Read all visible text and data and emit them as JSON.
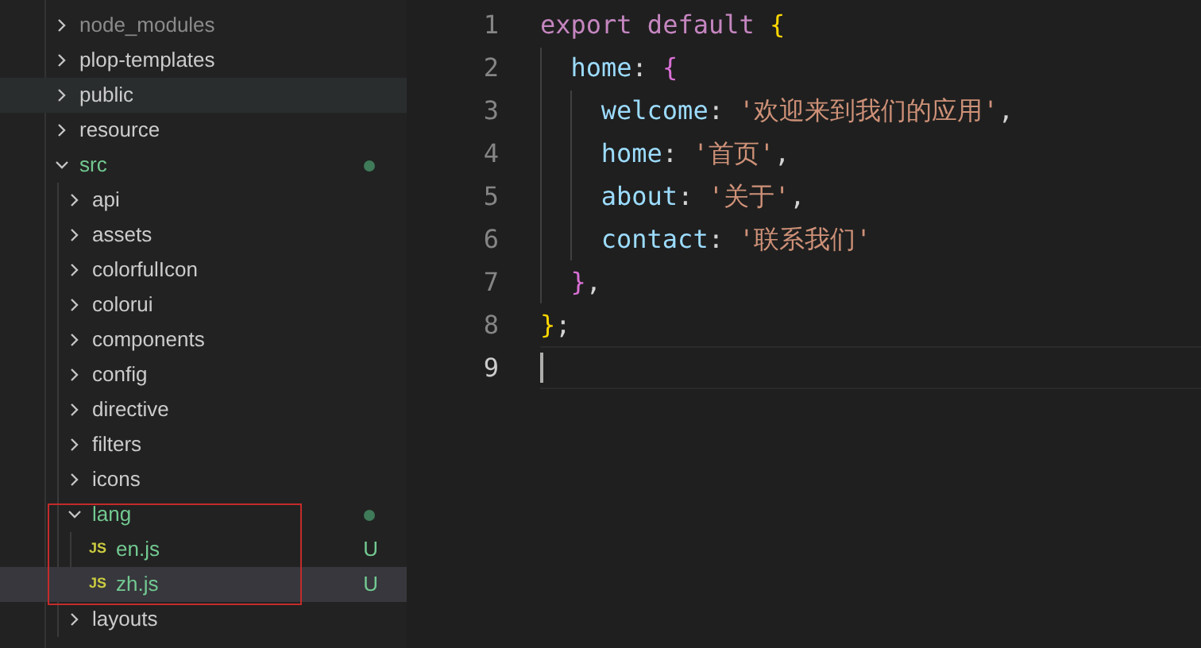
{
  "explorer": {
    "items": [
      {
        "label": "node_modules",
        "kind": "folder",
        "expanded": false,
        "ignored": true,
        "modified": false,
        "hovered": false,
        "selected": false,
        "outlined": false
      },
      {
        "label": "plop-templates",
        "kind": "folder",
        "expanded": false,
        "ignored": false,
        "modified": false,
        "hovered": false,
        "selected": false,
        "outlined": false
      },
      {
        "label": "public",
        "kind": "folder",
        "expanded": false,
        "ignored": false,
        "modified": false,
        "hovered": true,
        "selected": false,
        "outlined": false
      },
      {
        "label": "resource",
        "kind": "folder",
        "expanded": false,
        "ignored": false,
        "modified": false,
        "hovered": false,
        "selected": false,
        "outlined": false
      },
      {
        "label": "src",
        "kind": "folder",
        "expanded": true,
        "ignored": false,
        "modified": true,
        "hovered": false,
        "selected": false,
        "outlined": false,
        "children": [
          {
            "label": "api",
            "kind": "folder",
            "expanded": false,
            "ignored": false,
            "modified": false,
            "hovered": false,
            "selected": false,
            "outlined": false
          },
          {
            "label": "assets",
            "kind": "folder",
            "expanded": false,
            "ignored": false,
            "modified": false,
            "hovered": false,
            "selected": false,
            "outlined": false
          },
          {
            "label": "colorfulIcon",
            "kind": "folder",
            "expanded": false,
            "ignored": false,
            "modified": false,
            "hovered": false,
            "selected": false,
            "outlined": false
          },
          {
            "label": "colorui",
            "kind": "folder",
            "expanded": false,
            "ignored": false,
            "modified": false,
            "hovered": false,
            "selected": false,
            "outlined": false
          },
          {
            "label": "components",
            "kind": "folder",
            "expanded": false,
            "ignored": false,
            "modified": false,
            "hovered": false,
            "selected": false,
            "outlined": false
          },
          {
            "label": "config",
            "kind": "folder",
            "expanded": false,
            "ignored": false,
            "modified": false,
            "hovered": false,
            "selected": false,
            "outlined": false
          },
          {
            "label": "directive",
            "kind": "folder",
            "expanded": false,
            "ignored": false,
            "modified": false,
            "hovered": false,
            "selected": false,
            "outlined": false
          },
          {
            "label": "filters",
            "kind": "folder",
            "expanded": false,
            "ignored": false,
            "modified": false,
            "hovered": false,
            "selected": false,
            "outlined": false
          },
          {
            "label": "icons",
            "kind": "folder",
            "expanded": false,
            "ignored": false,
            "modified": false,
            "hovered": false,
            "selected": false,
            "outlined": false
          },
          {
            "label": "lang",
            "kind": "folder",
            "expanded": true,
            "ignored": false,
            "modified": true,
            "hovered": false,
            "selected": false,
            "outlined": true,
            "children": [
              {
                "label": "en.js",
                "kind": "file",
                "icon_text": "JS",
                "ignored": false,
                "modified": false,
                "status": "U",
                "hovered": false,
                "selected": false,
                "outlined": false
              },
              {
                "label": "zh.js",
                "kind": "file",
                "icon_text": "JS",
                "ignored": false,
                "modified": false,
                "status": "U",
                "hovered": false,
                "selected": true,
                "outlined": false
              }
            ]
          },
          {
            "label": "layouts",
            "kind": "folder",
            "expanded": false,
            "ignored": false,
            "modified": false,
            "hovered": false,
            "selected": false,
            "outlined": false
          }
        ]
      }
    ]
  },
  "editor": {
    "lines": [
      {
        "number": "1",
        "current": false,
        "tokens": [
          {
            "text": "export default ",
            "kind": "keyword"
          },
          {
            "text": "{",
            "kind": "brace1"
          }
        ],
        "children": [
          {
            "number": "2",
            "current": false,
            "tokens": [
              {
                "text": "home",
                "kind": "property"
              },
              {
                "text": ": ",
                "kind": "punct"
              },
              {
                "text": "{",
                "kind": "brace2"
              }
            ],
            "children": [
              {
                "number": "3",
                "current": false,
                "tokens": [
                  {
                    "text": "welcome",
                    "kind": "property"
                  },
                  {
                    "text": ": ",
                    "kind": "punct"
                  },
                  {
                    "text": "'欢迎来到我们的应用'",
                    "kind": "string"
                  },
                  {
                    "text": ",",
                    "kind": "punct"
                  }
                ]
              },
              {
                "number": "4",
                "current": false,
                "tokens": [
                  {
                    "text": "home",
                    "kind": "property"
                  },
                  {
                    "text": ": ",
                    "kind": "punct"
                  },
                  {
                    "text": "'首页'",
                    "kind": "string"
                  },
                  {
                    "text": ",",
                    "kind": "punct"
                  }
                ]
              },
              {
                "number": "5",
                "current": false,
                "tokens": [
                  {
                    "text": "about",
                    "kind": "property"
                  },
                  {
                    "text": ": ",
                    "kind": "punct"
                  },
                  {
                    "text": "'关于'",
                    "kind": "string"
                  },
                  {
                    "text": ",",
                    "kind": "punct"
                  }
                ]
              },
              {
                "number": "6",
                "current": false,
                "tokens": [
                  {
                    "text": "contact",
                    "kind": "property"
                  },
                  {
                    "text": ": ",
                    "kind": "punct"
                  },
                  {
                    "text": "'联系我们'",
                    "kind": "string"
                  }
                ]
              }
            ]
          },
          {
            "number": "7",
            "current": false,
            "tokens": [
              {
                "text": "}",
                "kind": "brace2"
              },
              {
                "text": ",",
                "kind": "punct"
              }
            ]
          }
        ]
      },
      {
        "number": "8",
        "current": false,
        "tokens": [
          {
            "text": "}",
            "kind": "brace1"
          },
          {
            "text": ";",
            "kind": "punct"
          }
        ]
      },
      {
        "number": "9",
        "current": true
      }
    ]
  }
}
